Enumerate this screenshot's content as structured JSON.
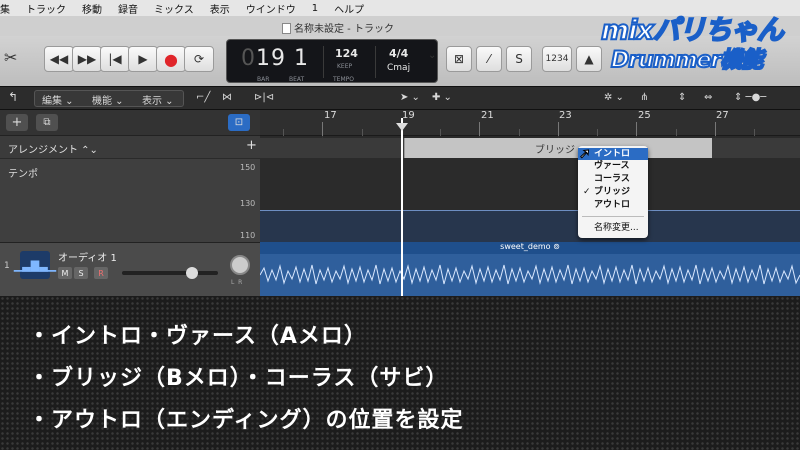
{
  "menubar": [
    "集",
    "トラック",
    "移動",
    "録音",
    "ミックス",
    "表示",
    "ウインドウ",
    "1",
    "ヘルプ"
  ],
  "window": {
    "title": "名称未設定 - トラック"
  },
  "lcd": {
    "bar_prefix": "0",
    "bar": "19",
    "beat": "1",
    "bar_label": "BAR",
    "beat_label": "BEAT",
    "tempo": "124",
    "tempo_mode": "KEEP",
    "tempo_label": "TEMPO",
    "signature": "4/4",
    "key": "Cmaj"
  },
  "transport_right": {
    "count_in": "1234"
  },
  "logo": {
    "line1": "mixパリちゃん",
    "line2": "Drummer機能"
  },
  "toolbar": {
    "edit": "編集",
    "functions": "機能",
    "view": "表示"
  },
  "arrangement_header": {
    "label": "アレンジメント"
  },
  "tempo_lane": {
    "label": "テンポ",
    "scale": [
      "150",
      "130",
      "110"
    ]
  },
  "track": {
    "number": "1",
    "name": "オーディオ 1",
    "mute": "M",
    "solo": "S",
    "record": "R",
    "pan_l": "L",
    "pan_r": "R"
  },
  "ruler": {
    "bars": [
      "17",
      "19",
      "21",
      "23",
      "25",
      "27"
    ]
  },
  "marker": {
    "label": "ブリッジ"
  },
  "region": {
    "name": "sweet_demo"
  },
  "context_menu": {
    "items": [
      "イントロ",
      "ヴァース",
      "コーラス",
      "ブリッジ",
      "アウトロ"
    ],
    "highlighted": "イントロ",
    "checked": "ブリッジ",
    "rename": "名称変更..."
  },
  "caption": {
    "lines": [
      "・イントロ・ヴァース（Aメロ）",
      "・ブリッジ（Bメロ）・コーラス（サビ）",
      "・アウトロ（エンディング）の位置を設定"
    ]
  }
}
